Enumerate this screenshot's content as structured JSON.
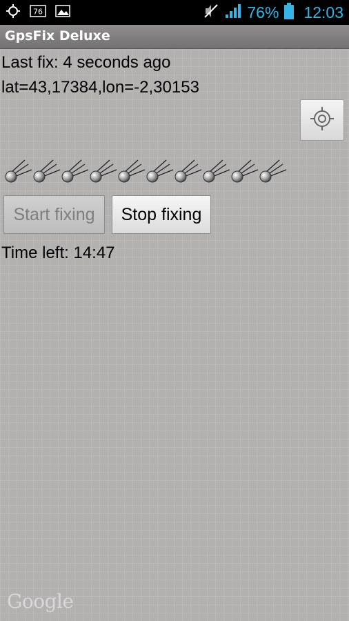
{
  "status_bar": {
    "icons_left": [
      "gps-icon",
      "notification-76-icon",
      "gallery-icon"
    ],
    "notification_badge": "76",
    "icons_right": [
      "mute-icon",
      "signal-icon",
      "battery-icon"
    ],
    "battery_percent": "76%",
    "time": "12:03",
    "accent_color": "#33b5e5"
  },
  "app": {
    "title": "GpsFix Deluxe"
  },
  "fix": {
    "last_fix": "Last fix: 4 seconds ago",
    "coords": " lat=43,17384,lon=-2,30153"
  },
  "locate_button": {
    "icon": "crosshair-icon"
  },
  "satellites": {
    "count": 10,
    "icon": "satellite-icon"
  },
  "buttons": {
    "start": "Start fixing",
    "stop": "Stop fixing",
    "start_enabled": false
  },
  "timer": {
    "time_left": "Time left: 14:47"
  },
  "map_attribution": "Google"
}
